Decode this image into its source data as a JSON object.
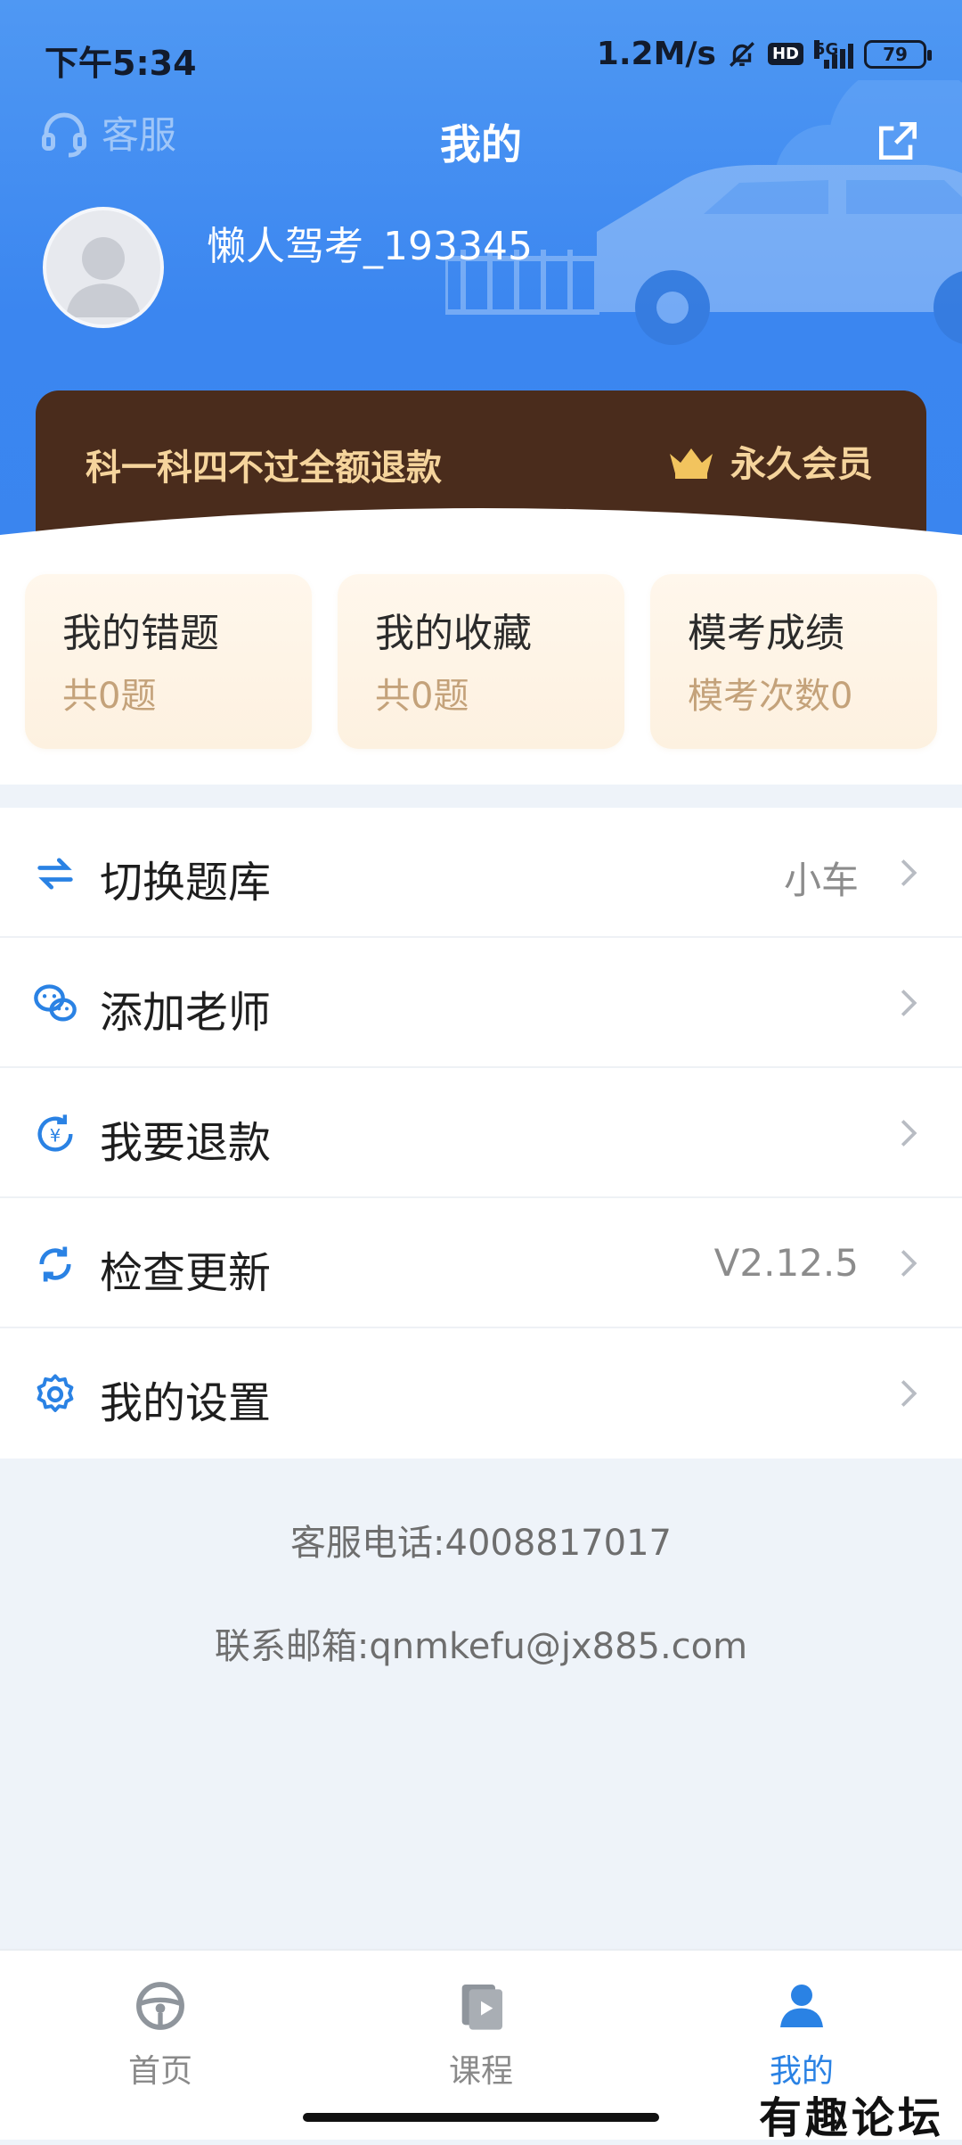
{
  "status_bar": {
    "time": "下午5:34",
    "net_speed": "1.2M/s",
    "hd": "HD",
    "network": "5G",
    "battery": "79"
  },
  "header": {
    "customer_service": "客服",
    "title": "我的"
  },
  "profile": {
    "username": "懒人驾考_193345"
  },
  "vip": {
    "promo": "科一科四不过全额退款",
    "badge": "永久会员",
    "color": "#4a2c1c",
    "text_color": "#f5d49c"
  },
  "stats": [
    {
      "title": "我的错题",
      "sub": "共0题"
    },
    {
      "title": "我的收藏",
      "sub": "共0题"
    },
    {
      "title": "模考成绩",
      "sub": "模考次数0"
    }
  ],
  "menu": [
    {
      "label": "切换题库",
      "value": "小车",
      "icon": "switch-icon"
    },
    {
      "label": "添加老师",
      "value": "",
      "icon": "wechat-icon"
    },
    {
      "label": "我要退款",
      "value": "",
      "icon": "refund-icon"
    },
    {
      "label": "检查更新",
      "value": "V2.12.5",
      "icon": "update-icon"
    },
    {
      "label": "我的设置",
      "value": "",
      "icon": "settings-icon"
    }
  ],
  "contact": {
    "phone": "客服电话:4008817017",
    "email": "联系邮箱:qnmkefu@jx885.com"
  },
  "tabs": [
    {
      "label": "首页",
      "icon": "steering-wheel-icon",
      "active": false
    },
    {
      "label": "课程",
      "icon": "course-icon",
      "active": false
    },
    {
      "label": "我的",
      "icon": "profile-icon",
      "active": true
    }
  ],
  "watermark": "有趣论坛",
  "accent_color": "#3b86f0"
}
